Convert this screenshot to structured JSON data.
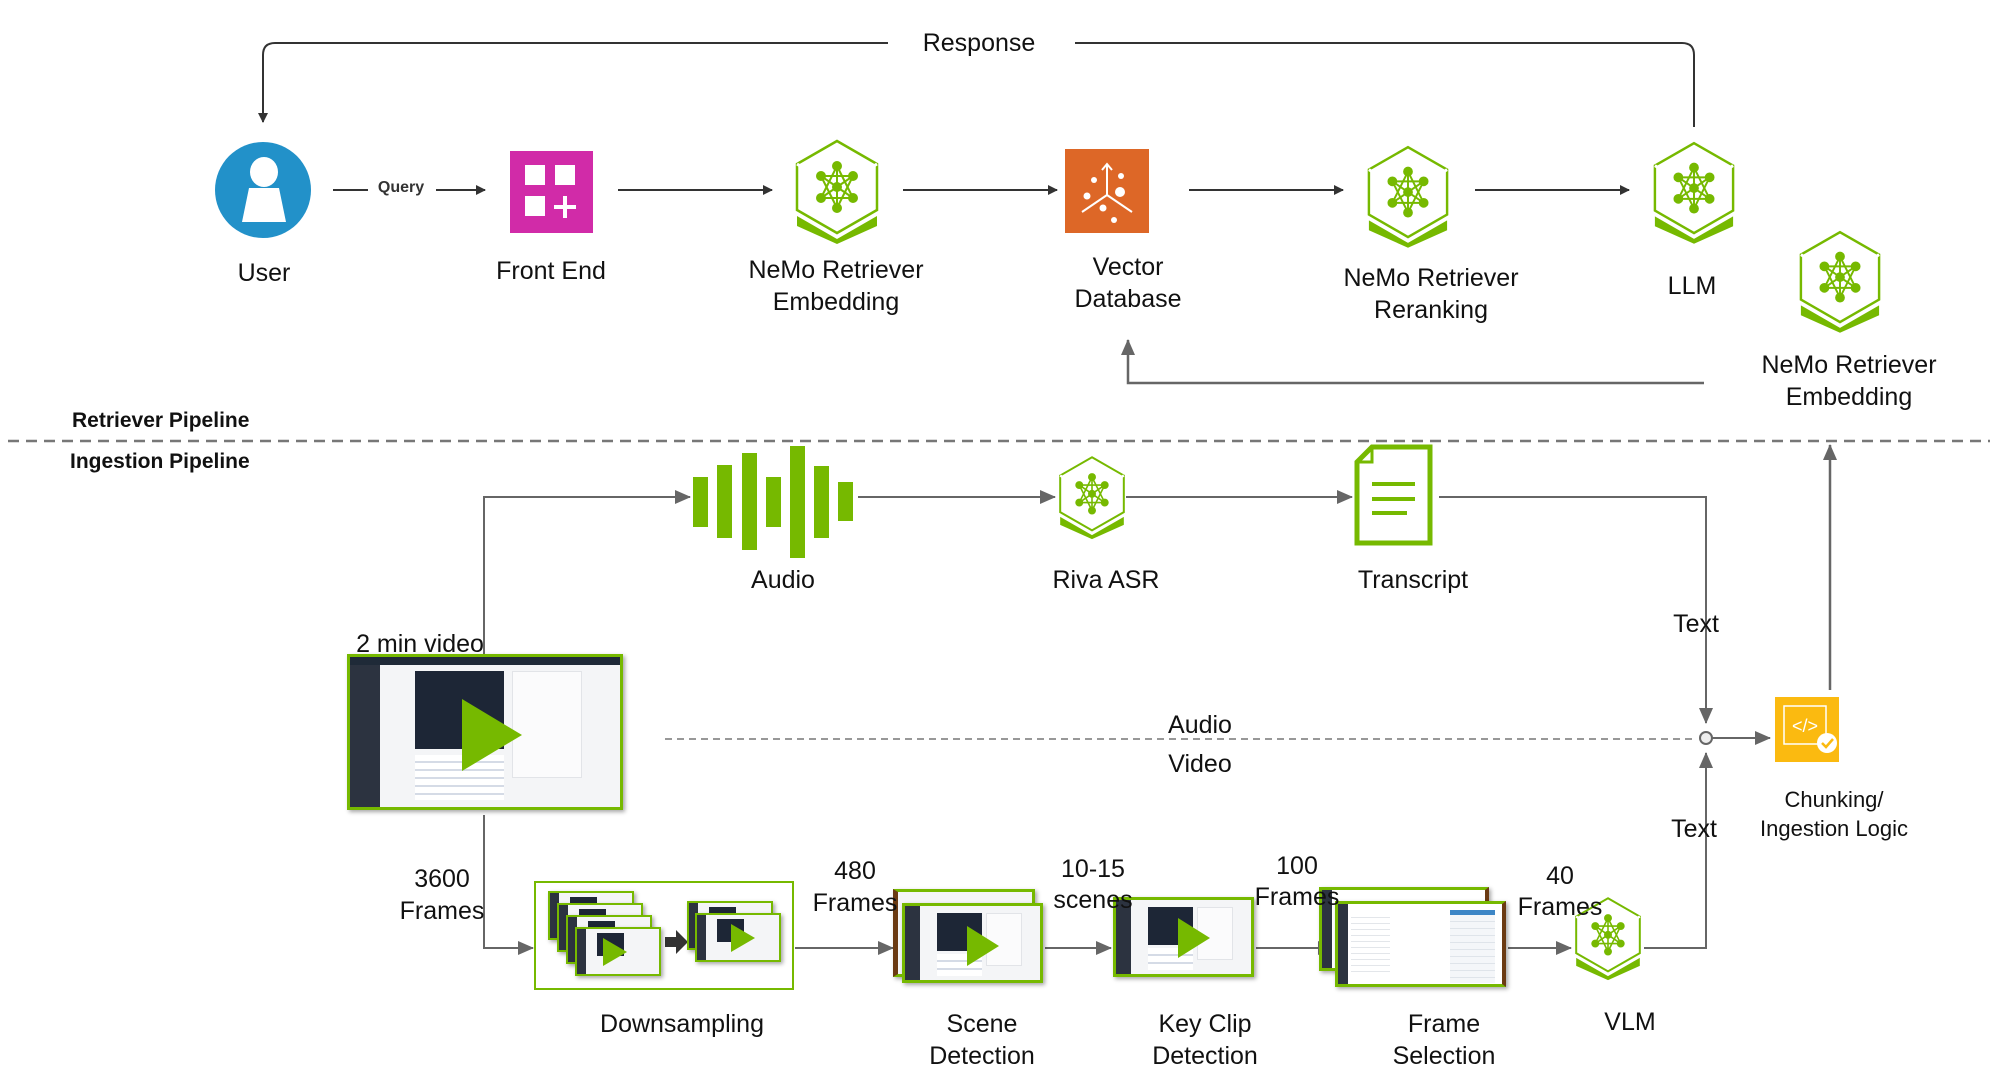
{
  "title": "Video RAG retriever and ingestion pipeline",
  "colors": {
    "nvidia_green": "#76b900",
    "user_blue": "#2291c9",
    "frontend_magenta": "#d12ba8",
    "vector_db_orange": "#dd6727",
    "chunking_yellow": "#fbba10",
    "line_gray": "#6b6b6b"
  },
  "sections": {
    "retriever": "Retriever Pipeline",
    "ingestion": "Ingestion Pipeline"
  },
  "retriever": {
    "response_label": "Response",
    "query_label": "Query",
    "nodes": [
      {
        "id": "user",
        "label": "User",
        "icon": "user-icon"
      },
      {
        "id": "front_end",
        "label": "Front End",
        "icon": "app-grid-icon"
      },
      {
        "id": "embedding",
        "label": "NeMo Retriever\nEmbedding",
        "line1": "NeMo Retriever",
        "line2": "Embedding",
        "icon": "nim-hexagon-icon"
      },
      {
        "id": "vector_db",
        "label": "Vector\nDatabase",
        "line1": "Vector",
        "line2": "Database",
        "icon": "vector-database-icon"
      },
      {
        "id": "reranking",
        "label": "NeMo Retriever\nReranking",
        "line1": "NeMo Retriever",
        "line2": "Reranking",
        "icon": "nim-hexagon-icon"
      },
      {
        "id": "llm",
        "label": "LLM",
        "icon": "nim-hexagon-icon"
      },
      {
        "id": "ingest_embedding",
        "label": "NeMo Retriever\nEmbedding",
        "line1": "NeMo Retriever",
        "line2": "Embedding",
        "icon": "nim-hexagon-icon"
      }
    ]
  },
  "ingestion": {
    "video_label": "2 min video",
    "audio_branch": {
      "audio": "Audio",
      "asr": "Riva ASR",
      "transcript": "Transcript",
      "text_label": "Text"
    },
    "split_labels": {
      "audio": "Audio",
      "video": "Video"
    },
    "video_branch": {
      "frames_3600": {
        "count": "3600",
        "unit": "Frames"
      },
      "downsampling": "Downsampling",
      "frames_480": {
        "count": "480",
        "unit": "Frames"
      },
      "scene_detection": {
        "line1": "Scene",
        "line2": "Detection"
      },
      "scenes": {
        "count": "10-15",
        "unit": "scenes"
      },
      "key_clip_detection": {
        "line1": "Key Clip",
        "line2": "Detection"
      },
      "frames_100": {
        "count": "100",
        "unit": "Frames"
      },
      "frame_selection": {
        "line1": "Frame",
        "line2": "Selection"
      },
      "frames_40": {
        "count": "40",
        "unit": "Frames"
      },
      "vlm": "VLM",
      "text_label": "Text"
    },
    "chunking": {
      "line1": "Chunking/",
      "line2": "Ingestion Logic"
    }
  }
}
